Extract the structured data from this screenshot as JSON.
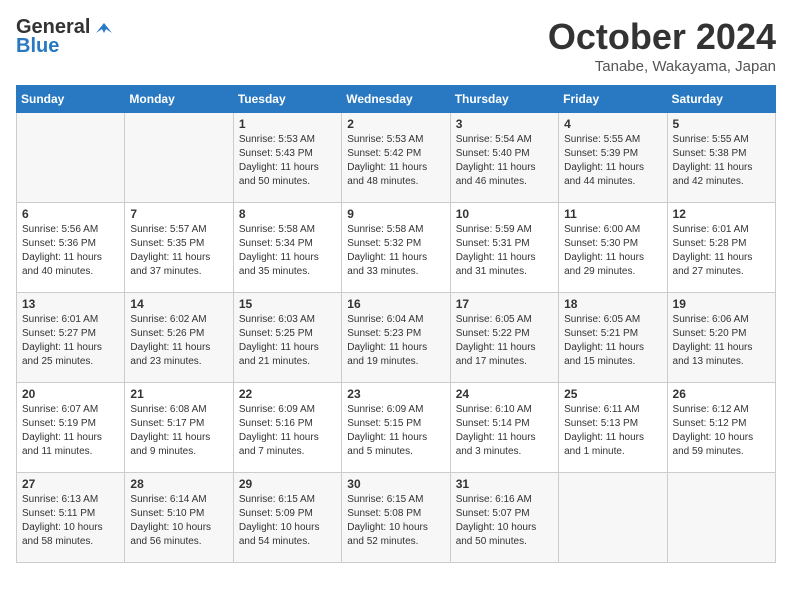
{
  "header": {
    "logo_line1": "General",
    "logo_line2": "Blue",
    "month": "October 2024",
    "location": "Tanabe, Wakayama, Japan"
  },
  "weekdays": [
    "Sunday",
    "Monday",
    "Tuesday",
    "Wednesday",
    "Thursday",
    "Friday",
    "Saturday"
  ],
  "weeks": [
    [
      {
        "day": "",
        "sunrise": "",
        "sunset": "",
        "daylight": ""
      },
      {
        "day": "",
        "sunrise": "",
        "sunset": "",
        "daylight": ""
      },
      {
        "day": "1",
        "sunrise": "Sunrise: 5:53 AM",
        "sunset": "Sunset: 5:43 PM",
        "daylight": "Daylight: 11 hours and 50 minutes."
      },
      {
        "day": "2",
        "sunrise": "Sunrise: 5:53 AM",
        "sunset": "Sunset: 5:42 PM",
        "daylight": "Daylight: 11 hours and 48 minutes."
      },
      {
        "day": "3",
        "sunrise": "Sunrise: 5:54 AM",
        "sunset": "Sunset: 5:40 PM",
        "daylight": "Daylight: 11 hours and 46 minutes."
      },
      {
        "day": "4",
        "sunrise": "Sunrise: 5:55 AM",
        "sunset": "Sunset: 5:39 PM",
        "daylight": "Daylight: 11 hours and 44 minutes."
      },
      {
        "day": "5",
        "sunrise": "Sunrise: 5:55 AM",
        "sunset": "Sunset: 5:38 PM",
        "daylight": "Daylight: 11 hours and 42 minutes."
      }
    ],
    [
      {
        "day": "6",
        "sunrise": "Sunrise: 5:56 AM",
        "sunset": "Sunset: 5:36 PM",
        "daylight": "Daylight: 11 hours and 40 minutes."
      },
      {
        "day": "7",
        "sunrise": "Sunrise: 5:57 AM",
        "sunset": "Sunset: 5:35 PM",
        "daylight": "Daylight: 11 hours and 37 minutes."
      },
      {
        "day": "8",
        "sunrise": "Sunrise: 5:58 AM",
        "sunset": "Sunset: 5:34 PM",
        "daylight": "Daylight: 11 hours and 35 minutes."
      },
      {
        "day": "9",
        "sunrise": "Sunrise: 5:58 AM",
        "sunset": "Sunset: 5:32 PM",
        "daylight": "Daylight: 11 hours and 33 minutes."
      },
      {
        "day": "10",
        "sunrise": "Sunrise: 5:59 AM",
        "sunset": "Sunset: 5:31 PM",
        "daylight": "Daylight: 11 hours and 31 minutes."
      },
      {
        "day": "11",
        "sunrise": "Sunrise: 6:00 AM",
        "sunset": "Sunset: 5:30 PM",
        "daylight": "Daylight: 11 hours and 29 minutes."
      },
      {
        "day": "12",
        "sunrise": "Sunrise: 6:01 AM",
        "sunset": "Sunset: 5:28 PM",
        "daylight": "Daylight: 11 hours and 27 minutes."
      }
    ],
    [
      {
        "day": "13",
        "sunrise": "Sunrise: 6:01 AM",
        "sunset": "Sunset: 5:27 PM",
        "daylight": "Daylight: 11 hours and 25 minutes."
      },
      {
        "day": "14",
        "sunrise": "Sunrise: 6:02 AM",
        "sunset": "Sunset: 5:26 PM",
        "daylight": "Daylight: 11 hours and 23 minutes."
      },
      {
        "day": "15",
        "sunrise": "Sunrise: 6:03 AM",
        "sunset": "Sunset: 5:25 PM",
        "daylight": "Daylight: 11 hours and 21 minutes."
      },
      {
        "day": "16",
        "sunrise": "Sunrise: 6:04 AM",
        "sunset": "Sunset: 5:23 PM",
        "daylight": "Daylight: 11 hours and 19 minutes."
      },
      {
        "day": "17",
        "sunrise": "Sunrise: 6:05 AM",
        "sunset": "Sunset: 5:22 PM",
        "daylight": "Daylight: 11 hours and 17 minutes."
      },
      {
        "day": "18",
        "sunrise": "Sunrise: 6:05 AM",
        "sunset": "Sunset: 5:21 PM",
        "daylight": "Daylight: 11 hours and 15 minutes."
      },
      {
        "day": "19",
        "sunrise": "Sunrise: 6:06 AM",
        "sunset": "Sunset: 5:20 PM",
        "daylight": "Daylight: 11 hours and 13 minutes."
      }
    ],
    [
      {
        "day": "20",
        "sunrise": "Sunrise: 6:07 AM",
        "sunset": "Sunset: 5:19 PM",
        "daylight": "Daylight: 11 hours and 11 minutes."
      },
      {
        "day": "21",
        "sunrise": "Sunrise: 6:08 AM",
        "sunset": "Sunset: 5:17 PM",
        "daylight": "Daylight: 11 hours and 9 minutes."
      },
      {
        "day": "22",
        "sunrise": "Sunrise: 6:09 AM",
        "sunset": "Sunset: 5:16 PM",
        "daylight": "Daylight: 11 hours and 7 minutes."
      },
      {
        "day": "23",
        "sunrise": "Sunrise: 6:09 AM",
        "sunset": "Sunset: 5:15 PM",
        "daylight": "Daylight: 11 hours and 5 minutes."
      },
      {
        "day": "24",
        "sunrise": "Sunrise: 6:10 AM",
        "sunset": "Sunset: 5:14 PM",
        "daylight": "Daylight: 11 hours and 3 minutes."
      },
      {
        "day": "25",
        "sunrise": "Sunrise: 6:11 AM",
        "sunset": "Sunset: 5:13 PM",
        "daylight": "Daylight: 11 hours and 1 minute."
      },
      {
        "day": "26",
        "sunrise": "Sunrise: 6:12 AM",
        "sunset": "Sunset: 5:12 PM",
        "daylight": "Daylight: 10 hours and 59 minutes."
      }
    ],
    [
      {
        "day": "27",
        "sunrise": "Sunrise: 6:13 AM",
        "sunset": "Sunset: 5:11 PM",
        "daylight": "Daylight: 10 hours and 58 minutes."
      },
      {
        "day": "28",
        "sunrise": "Sunrise: 6:14 AM",
        "sunset": "Sunset: 5:10 PM",
        "daylight": "Daylight: 10 hours and 56 minutes."
      },
      {
        "day": "29",
        "sunrise": "Sunrise: 6:15 AM",
        "sunset": "Sunset: 5:09 PM",
        "daylight": "Daylight: 10 hours and 54 minutes."
      },
      {
        "day": "30",
        "sunrise": "Sunrise: 6:15 AM",
        "sunset": "Sunset: 5:08 PM",
        "daylight": "Daylight: 10 hours and 52 minutes."
      },
      {
        "day": "31",
        "sunrise": "Sunrise: 6:16 AM",
        "sunset": "Sunset: 5:07 PM",
        "daylight": "Daylight: 10 hours and 50 minutes."
      },
      {
        "day": "",
        "sunrise": "",
        "sunset": "",
        "daylight": ""
      },
      {
        "day": "",
        "sunrise": "",
        "sunset": "",
        "daylight": ""
      }
    ]
  ]
}
